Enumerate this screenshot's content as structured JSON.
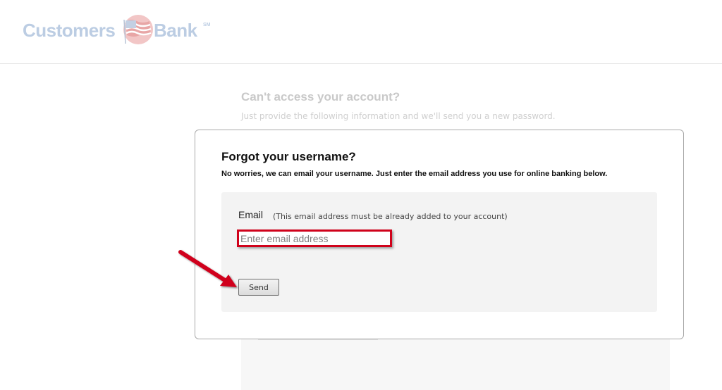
{
  "header": {
    "logo_left": "Customers",
    "logo_right": "Bank",
    "logo_mark": "SM"
  },
  "background": {
    "title": "Can't access your account?",
    "subtitle": "Just provide the following information and we'll send you a new password."
  },
  "modal": {
    "title": "Forgot your username?",
    "description": "No worries, we can email your username. Just enter the email address you use for online banking below.",
    "email_label": "Email",
    "email_note": "(This email address must be already added to your account)",
    "email_placeholder": "Enter email address",
    "email_value": "",
    "send_label": "Send"
  },
  "colors": {
    "highlight": "#d0021b",
    "logo": "#bccde3"
  },
  "icons": [
    "flag-icon",
    "red-arrow-icon"
  ]
}
